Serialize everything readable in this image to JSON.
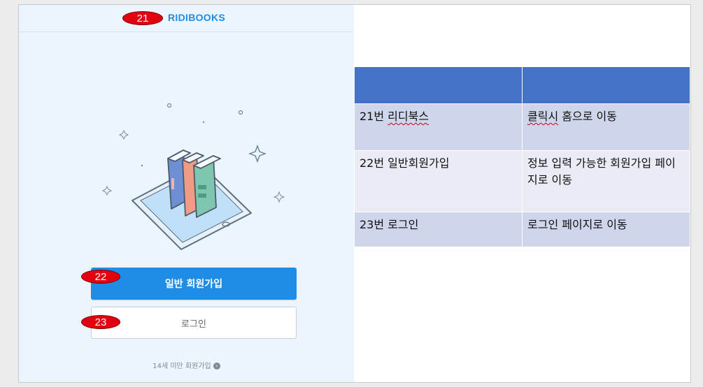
{
  "phone": {
    "logo": "RIDIBOOKS",
    "signup_button": "일반 회원가입",
    "login_button": "로그인",
    "minor_signup_link": "14세 미만 회원가입",
    "minor_signup_arrow": "›"
  },
  "annotations": [
    "21",
    "22",
    "23"
  ],
  "table": {
    "headers": [
      "",
      ""
    ],
    "rows": [
      {
        "number": "21번 ",
        "item": "리디북스",
        "desc_a": "클릭시",
        "desc_b": " 홈으로 이동"
      },
      {
        "number": "22번 ",
        "item": "일반회원가입",
        "desc_a": "정보 입력 가능한 회원가입 페이지로 이동",
        "desc_b": ""
      },
      {
        "number": "23번 ",
        "item": "로그인",
        "desc_a": "로그인 페이지로 이동",
        "desc_b": ""
      }
    ]
  },
  "colors": {
    "brand_blue": "#1f8ce6",
    "header_blue": "#4472c4",
    "annotation_red": "#e3000f"
  }
}
